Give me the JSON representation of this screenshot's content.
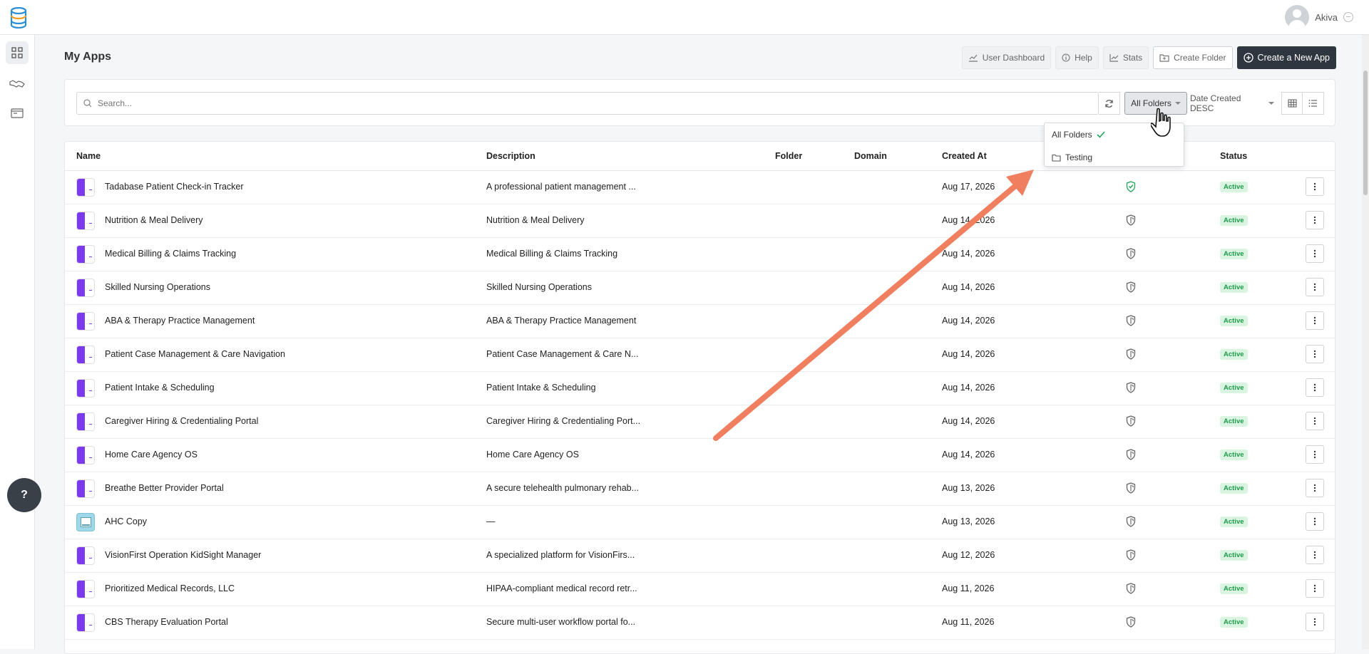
{
  "header": {
    "user_name": "Akiva"
  },
  "page": {
    "title": "My Apps"
  },
  "actions": {
    "user_dashboard": "User Dashboard",
    "help": "Help",
    "stats": "Stats",
    "create_folder": "Create Folder",
    "create_app": "Create a New App"
  },
  "filters": {
    "search_placeholder": "Search...",
    "folder_selected": "All Folders",
    "sort_selected": "Date Created DESC"
  },
  "folder_dropdown": {
    "items": [
      {
        "label": "All Folders",
        "selected": true
      },
      {
        "label": "Testing",
        "selected": false
      }
    ]
  },
  "table": {
    "columns": [
      "Name",
      "Description",
      "Folder",
      "Domain",
      "Created At",
      "Status"
    ],
    "rows": [
      {
        "name": "Tadabase Patient Check-in Tracker",
        "description": "A professional patient management ...",
        "created": "Aug 17, 2026",
        "status": "Active",
        "verified": true
      },
      {
        "name": "Nutrition & Meal Delivery",
        "description": "Nutrition & Meal Delivery",
        "created": "Aug 14, 2026",
        "status": "Active",
        "verified": false
      },
      {
        "name": "Medical Billing & Claims Tracking",
        "description": "Medical Billing & Claims Tracking",
        "created": "Aug 14, 2026",
        "status": "Active",
        "verified": false
      },
      {
        "name": "Skilled Nursing Operations",
        "description": "Skilled Nursing Operations",
        "created": "Aug 14, 2026",
        "status": "Active",
        "verified": false
      },
      {
        "name": "ABA & Therapy Practice Management",
        "description": "ABA & Therapy Practice Management",
        "created": "Aug 14, 2026",
        "status": "Active",
        "verified": false
      },
      {
        "name": "Patient Case Management & Care Navigation",
        "description": "Patient Case Management & Care N...",
        "created": "Aug 14, 2026",
        "status": "Active",
        "verified": false
      },
      {
        "name": "Patient Intake & Scheduling",
        "description": "Patient Intake & Scheduling",
        "created": "Aug 14, 2026",
        "status": "Active",
        "verified": false
      },
      {
        "name": "Caregiver Hiring & Credentialing Portal",
        "description": "Caregiver Hiring & Credentialing Port...",
        "created": "Aug 14, 2026",
        "status": "Active",
        "verified": false
      },
      {
        "name": "Home Care Agency OS",
        "description": "Home Care Agency OS",
        "created": "Aug 14, 2026",
        "status": "Active",
        "verified": false
      },
      {
        "name": "Breathe Better Provider Portal",
        "description": "A secure telehealth pulmonary rehab...",
        "created": "Aug 13, 2026",
        "status": "Active",
        "verified": false
      },
      {
        "name": "AHC Copy",
        "description": "—",
        "created": "Aug 13, 2026",
        "status": "Active",
        "verified": false,
        "icon": "alt"
      },
      {
        "name": "VisionFirst Operation KidSight Manager",
        "description": "A specialized platform for VisionFirs...",
        "created": "Aug 12, 2026",
        "status": "Active",
        "verified": false
      },
      {
        "name": "Prioritized Medical Records, LLC",
        "description": "HIPAA-compliant medical record retr...",
        "created": "Aug 11, 2026",
        "status": "Active",
        "verified": false
      },
      {
        "name": "CBS Therapy Evaluation Portal",
        "description": "Secure multi-user workflow portal fo...",
        "created": "Aug 11, 2026",
        "status": "Active",
        "verified": false
      }
    ]
  },
  "help_fab": "?",
  "colors": {
    "accent": "#7c3aed",
    "status_active": "#1f9a4a",
    "verified": "#22a55a",
    "arrow": "#f07f5f"
  }
}
